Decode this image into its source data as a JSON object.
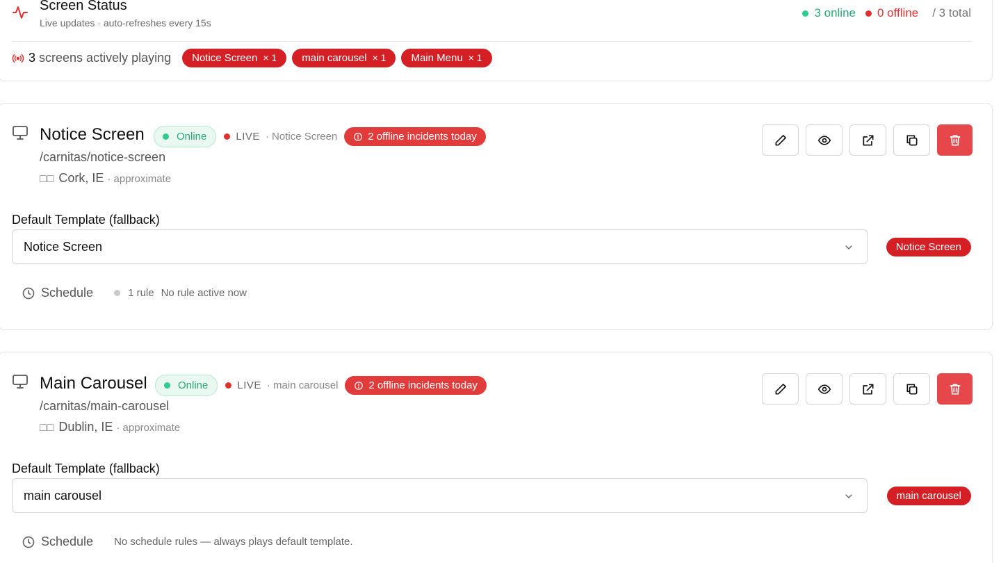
{
  "status": {
    "title": "Screen Status",
    "subtitle": "Live updates · auto-refreshes every 15s",
    "online_label": "3 online",
    "offline_label": "0 offline",
    "total_label": "/ 3 total",
    "online_color": "#2aa876",
    "offline_color": "#e03131",
    "playing_count": "3",
    "playing_text": "screens actively playing",
    "playing_chips": [
      {
        "name": "Notice Screen",
        "mult": "× 1"
      },
      {
        "name": "main carousel",
        "mult": "× 1"
      },
      {
        "name": "Main Menu",
        "mult": "× 1"
      }
    ]
  },
  "screens": [
    {
      "name": "Notice Screen",
      "status": "Online",
      "live_label": "LIVE",
      "live_template": "· Notice Screen",
      "incidents": "2 offline incidents today",
      "path": "/carnitas/notice-screen",
      "flag": "□□",
      "location": "Cork, IE",
      "location_note": "· approximate",
      "field_label": "Default Template (fallback)",
      "selected_template": "Notice Screen",
      "template_badge": "Notice Screen",
      "schedule_label": "Schedule",
      "rule_count": "1 rule",
      "rule_status": "No rule active now"
    },
    {
      "name": "Main Carousel",
      "status": "Online",
      "live_label": "LIVE",
      "live_template": "· main carousel",
      "incidents": "2 offline incidents today",
      "path": "/carnitas/main-carousel",
      "flag": "□□",
      "location": "Dublin, IE",
      "location_note": "· approximate",
      "field_label": "Default Template (fallback)",
      "selected_template": "main carousel",
      "template_badge": "main carousel",
      "schedule_label": "Schedule",
      "no_rules": "No schedule rules — always plays default template."
    }
  ],
  "icons": {
    "status": "pulse-icon",
    "playing": "broadcast-icon",
    "screen": "monitor-icon",
    "edit": "pencil-icon",
    "preview": "eye-icon",
    "open": "external-link-icon",
    "duplicate": "copy-icon",
    "delete": "trash-icon",
    "schedule": "clock-icon",
    "select": "chevron-down-icon",
    "incident": "alert-circle-icon"
  },
  "colors": {
    "brand_red": "#d41f25",
    "danger_button": "#e6474a",
    "online_green": "#2aa876",
    "online_bg": "#e9f8f1"
  }
}
